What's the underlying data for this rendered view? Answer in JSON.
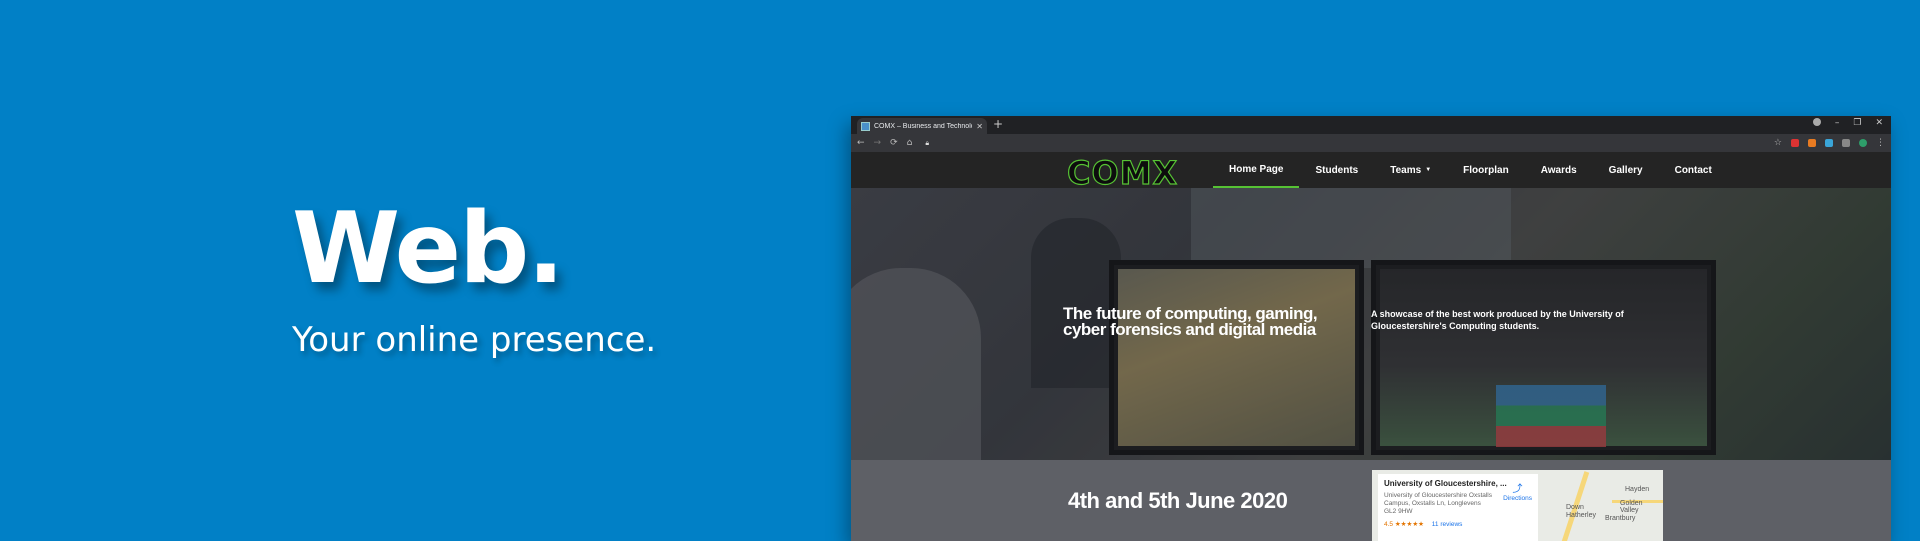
{
  "hero": {
    "title": "Web.",
    "subtitle": "Your online presence."
  },
  "browser": {
    "tab_title": "COMX – Business and Technology",
    "tab_close": "✕",
    "new_tab": "+",
    "window_controls": [
      "–",
      "❐",
      "✕"
    ]
  },
  "site": {
    "logo": "COMX",
    "nav": [
      {
        "label": "Home Page",
        "active": true
      },
      {
        "label": "Students"
      },
      {
        "label": "Teams",
        "dropdown": true
      },
      {
        "label": "Floorplan"
      },
      {
        "label": "Awards"
      },
      {
        "label": "Gallery"
      },
      {
        "label": "Contact"
      }
    ],
    "banner_heading": "The future of computing, gaming, cyber forensics and digital media",
    "banner_text": "A showcase of the best work produced by the University of Gloucestershire's Computing students.",
    "dates": "4th and 5th June 2020",
    "map": {
      "place_name": "University of Gloucestershire, ...",
      "address": "University of Gloucestershire Oxstalls Campus, Oxstalls Ln, Longlevens GL2 9HW",
      "rating": "4.5 ★★★★★",
      "reviews": "11 reviews",
      "directions": "Directions",
      "labels": [
        "Hayden",
        "Golden Valley",
        "Down Hatherley",
        "Brantbury"
      ]
    }
  },
  "colors": {
    "background": "#0180c6",
    "accent": "#56c234"
  }
}
